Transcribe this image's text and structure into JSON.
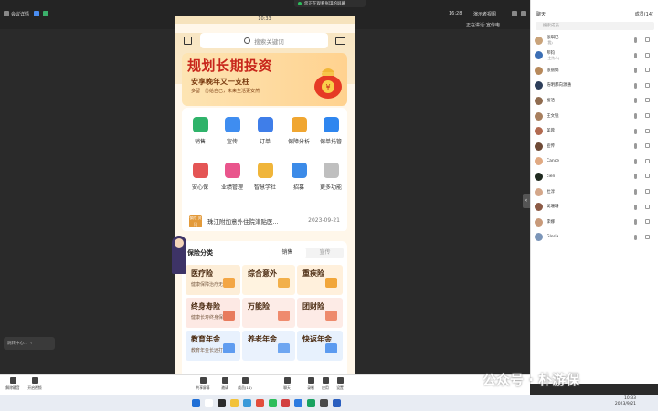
{
  "topbar": {
    "left_label": "会议详情",
    "recording": "16:28",
    "right_labels": [
      "正在讲话:",
      "宣传电"
    ],
    "view_label": "演示者视图",
    "chat_label": "聊天",
    "members_label": "成员(14)",
    "cast_label": "您正在观看张琪的屏幕"
  },
  "phone": {
    "time": "10:33",
    "search_placeholder": "搜索关键词",
    "banner": {
      "title": "规划长期投资",
      "sub": "安享晚年又一支柱",
      "sub2": "多留一份给自己，未来生活更安然"
    },
    "grid": [
      {
        "label": "销售",
        "color": "#2fb36a"
      },
      {
        "label": "宣传",
        "color": "#3f8df0"
      },
      {
        "label": "订单",
        "color": "#3f7ee9"
      },
      {
        "label": "保障分析",
        "color": "#f0a631"
      },
      {
        "label": "保单托管",
        "color": "#2f86ef"
      },
      {
        "label": "安心保",
        "color": "#e45555"
      },
      {
        "label": "业绩管理",
        "color": "#e9558c"
      },
      {
        "label": "智慧学社",
        "color": "#f0b53a"
      },
      {
        "label": "招募",
        "color": "#3c8be8"
      },
      {
        "label": "更多功能",
        "color": "#bfbfbf"
      }
    ],
    "notice": {
      "icon_text": "保险 资讯",
      "text": "珠江附加意外住院津贴医...",
      "date": "2023-09-21"
    },
    "categories": {
      "title": "保险分类",
      "tabs": [
        "销售",
        "宣传"
      ],
      "cells": [
        {
          "name": "医疗险",
          "sub": "健康保障治疗无忧",
          "bg": "#fdeed8",
          "ic": "#f3a644"
        },
        {
          "name": "综合意外",
          "sub": "",
          "bg": "#fff3e0",
          "ic": "#f2b04a"
        },
        {
          "name": "重疾险",
          "sub": "",
          "bg": "#fff0dc",
          "ic": "#f1a63a"
        },
        {
          "name": "终身寿险",
          "sub": "健康长寿终身保障",
          "bg": "#fde9e4",
          "ic": "#e87b5d"
        },
        {
          "name": "万能险",
          "sub": "",
          "bg": "#fdece7",
          "ic": "#ef8b6e"
        },
        {
          "name": "团财险",
          "sub": "",
          "bg": "#fdebe6",
          "ic": "#ee8a6c"
        },
        {
          "name": "教育年金",
          "sub": "教育年金长远打算",
          "bg": "#e8f1fd",
          "ic": "#5f9cf0"
        },
        {
          "name": "养老年金",
          "sub": "",
          "bg": "#eaf2fd",
          "ic": "#6ea6f1"
        },
        {
          "name": "快返年金",
          "sub": "",
          "bg": "#e7f1fd",
          "ic": "#5c9bf0"
        }
      ]
    }
  },
  "panel": {
    "search_placeholder": "搜索成员",
    "members": [
      {
        "name": "张琪巴",
        "role": "(我)"
      },
      {
        "name": "邦钧",
        "role": "(主持人)"
      },
      {
        "name": "张丽娟",
        "role": ""
      },
      {
        "name": "浩明郝向源通",
        "role": ""
      },
      {
        "name": "富活",
        "role": ""
      },
      {
        "name": "王文锐",
        "role": ""
      },
      {
        "name": "美蓉",
        "role": ""
      },
      {
        "name": "宣传",
        "role": ""
      },
      {
        "name": "Cance",
        "role": ""
      },
      {
        "name": "cien",
        "role": ""
      },
      {
        "name": "杜淳",
        "role": ""
      },
      {
        "name": "吴珊珊",
        "role": ""
      },
      {
        "name": "李娜",
        "role": ""
      },
      {
        "name": "Gloria",
        "role": ""
      }
    ]
  },
  "left_toast": "跳转中心...",
  "toolbar": [
    "解除静音",
    "开启视频",
    "共享屏幕",
    "邀请",
    "成员(14)",
    "聊天",
    "录制",
    "应用",
    "设置"
  ],
  "tray": {
    "time": "10:33",
    "date": "2023/9/21"
  },
  "watermark": "公众号 · 朴游保"
}
